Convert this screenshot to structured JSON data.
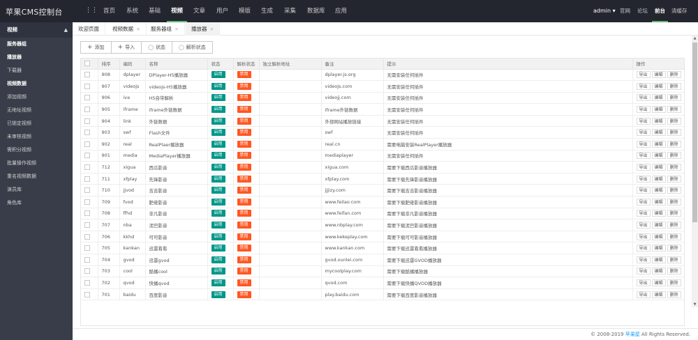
{
  "app": {
    "title": "苹果CMS控制台"
  },
  "topnav": {
    "menu_icon": "dots-icon",
    "items": [
      "首页",
      "系统",
      "基础",
      "视频",
      "文章",
      "用户",
      "模版",
      "生成",
      "采集",
      "数据库",
      "应用"
    ],
    "active_index": 3
  },
  "topright": {
    "user": "admin",
    "items": [
      "官网",
      "论坛",
      "前台",
      "清缓存"
    ],
    "active_index": 2
  },
  "sidebar": {
    "group": "视频",
    "items": [
      "服务器组",
      "播放器",
      "下载器",
      "视频数据",
      "添加视频",
      "无地址视频",
      "已锁定视频",
      "未审核视频",
      "需积分视频",
      "批量操作视频",
      "重名视频数据",
      "演员库",
      "角色库"
    ],
    "bold_indices": [
      0,
      1,
      3
    ]
  },
  "tabs": {
    "items": [
      "欢迎页面",
      "视频数据",
      "服务器组",
      "播放器"
    ],
    "active_index": 3
  },
  "toolbar": {
    "add": "添加",
    "import": "导入",
    "status": "状态",
    "parse_status": "解析状态"
  },
  "table": {
    "headers": [
      "",
      "排序",
      "编码",
      "名称",
      "状态",
      "解析状态",
      "独立解析地址",
      "备注",
      "提示",
      "操作"
    ],
    "status_on": "启用",
    "status_off": "禁用",
    "op_export": "导出",
    "op_edit": "编辑",
    "op_delete": "删除",
    "rows": [
      {
        "sort": "908",
        "code": "dplayer",
        "name": "DPlayer-H5播放器",
        "status": "on",
        "parse": "off",
        "addr": "",
        "remark": "dplayer.js.org",
        "tip": "无需安装任何插件"
      },
      {
        "sort": "907",
        "code": "videojs",
        "name": "videojs-H5播放器",
        "status": "on",
        "parse": "off",
        "addr": "",
        "remark": "videojs.com",
        "tip": "无需安装任何插件"
      },
      {
        "sort": "906",
        "code": "iva",
        "name": "H5自带解析",
        "status": "on",
        "parse": "off",
        "addr": "",
        "remark": "videojj.com",
        "tip": "无需安装任何插件"
      },
      {
        "sort": "905",
        "code": "iframe",
        "name": "iframe外链数据",
        "status": "on",
        "parse": "off",
        "addr": "",
        "remark": "iframe外链数据",
        "tip": "无需安装任何插件"
      },
      {
        "sort": "904",
        "code": "link",
        "name": "外链数据",
        "status": "on",
        "parse": "off",
        "addr": "",
        "remark": "外部网站播放链接",
        "tip": "无需安装任何插件"
      },
      {
        "sort": "903",
        "code": "swf",
        "name": "Flash文件",
        "status": "on",
        "parse": "off",
        "addr": "",
        "remark": "swf",
        "tip": "无需安装任何插件"
      },
      {
        "sort": "902",
        "code": "real",
        "name": "RealPlaer播放器",
        "status": "on",
        "parse": "off",
        "addr": "",
        "remark": "real.cn",
        "tip": "需要电脑安装RealPlayer播放器"
      },
      {
        "sort": "901",
        "code": "media",
        "name": "MediaPlayer播放器",
        "status": "on",
        "parse": "off",
        "addr": "",
        "remark": "mediaplayer",
        "tip": "无需安装任何插件"
      },
      {
        "sort": "712",
        "code": "xigua",
        "name": "西瓜影音",
        "status": "on",
        "parse": "off",
        "addr": "",
        "remark": "xigua.com",
        "tip": "需要下载西瓜影音播放器"
      },
      {
        "sort": "711",
        "code": "xfplay",
        "name": "先锋影音",
        "status": "on",
        "parse": "off",
        "addr": "",
        "remark": "xfplay.com",
        "tip": "需要下载先锋影音播放器"
      },
      {
        "sort": "710",
        "code": "jjvod",
        "name": "吉吉影音",
        "status": "on",
        "parse": "off",
        "addr": "",
        "remark": "jjjizy.com",
        "tip": "需要下载吉吉影音播放器"
      },
      {
        "sort": "709",
        "code": "fvod",
        "name": "肥佬影音",
        "status": "on",
        "parse": "off",
        "addr": "",
        "remark": "www.feilao.com",
        "tip": "需要下载肥佬影音播放器"
      },
      {
        "sort": "708",
        "code": "ffhd",
        "name": "非凡影音",
        "status": "on",
        "parse": "off",
        "addr": "",
        "remark": "www.feifan.com",
        "tip": "需要下载非凡影音播放器"
      },
      {
        "sort": "707",
        "code": "nba",
        "name": "泥巴影音",
        "status": "on",
        "parse": "off",
        "addr": "",
        "remark": "www.nbplay.com",
        "tip": "需要下载泥巴影音播放器"
      },
      {
        "sort": "706",
        "code": "kkhd",
        "name": "可可影音",
        "status": "on",
        "parse": "off",
        "addr": "",
        "remark": "www.kekeplay.com",
        "tip": "需要下载可可影音播放器"
      },
      {
        "sort": "705",
        "code": "kankan",
        "name": "迅雷看看",
        "status": "on",
        "parse": "off",
        "addr": "",
        "remark": "www.kankan.com",
        "tip": "需要下载迅雷看看播放器"
      },
      {
        "sort": "704",
        "code": "gvod",
        "name": "迅雷gvod",
        "status": "on",
        "parse": "off",
        "addr": "",
        "remark": "gvod.xunlei.com",
        "tip": "需要下载迅雷GVOD播放器"
      },
      {
        "sort": "703",
        "code": "cool",
        "name": "酷播cool",
        "status": "on",
        "parse": "off",
        "addr": "",
        "remark": "mycoolplay.com",
        "tip": "需要下载酷播播放器"
      },
      {
        "sort": "702",
        "code": "qvod",
        "name": "快播qvod",
        "status": "on",
        "parse": "off",
        "addr": "",
        "remark": "qvod.com",
        "tip": "需要下载快播QVOD播放器"
      },
      {
        "sort": "701",
        "code": "baidu",
        "name": "百度影音",
        "status": "on",
        "parse": "off",
        "addr": "",
        "remark": "play.baidu.com",
        "tip": "需要下载百度影音播放器"
      }
    ]
  },
  "footer": {
    "copyright": "© 2008-2019",
    "link": "苹果屋",
    "rights": "All Rights Reserved."
  }
}
